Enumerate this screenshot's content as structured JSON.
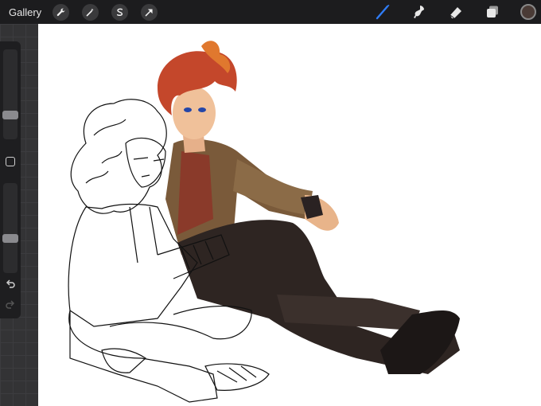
{
  "toolbar": {
    "gallery_label": "Gallery",
    "left_tools": [
      {
        "name": "actions-wrench-icon"
      },
      {
        "name": "adjustments-wand-icon"
      },
      {
        "name": "selection-s-icon"
      },
      {
        "name": "transform-arrow-icon"
      }
    ],
    "right_tools": [
      {
        "name": "brush-icon",
        "active": true
      },
      {
        "name": "smudge-icon",
        "active": false
      },
      {
        "name": "eraser-icon",
        "active": false
      },
      {
        "name": "layers-icon",
        "active": false
      }
    ],
    "current_color": "#4a3b36",
    "accent_color": "#2f7cf6"
  },
  "sidebar": {
    "brush_size": 0.27,
    "brush_opacity": 0.61,
    "modify_button": "square-modify-icon",
    "undo": "undo-icon",
    "redo": "redo-icon"
  },
  "canvas": {
    "content": "illustration"
  }
}
